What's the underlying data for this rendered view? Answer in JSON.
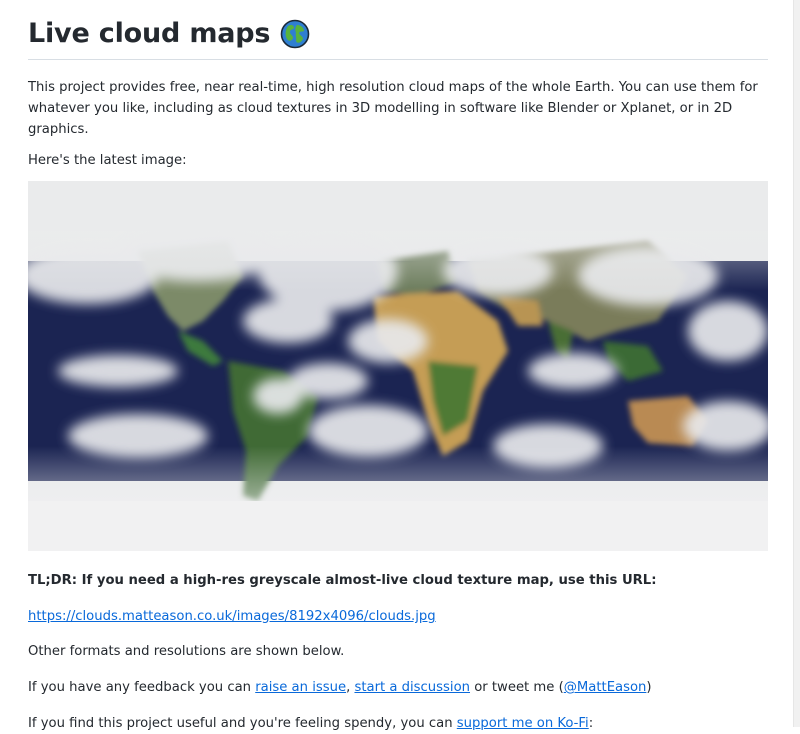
{
  "header": {
    "title": "Live cloud maps"
  },
  "intro": {
    "text": "This project provides free, near real-time, high resolution cloud maps of the whole Earth. You can use them for whatever you like, including as cloud textures in 3D modelling in software like Blender or Xplanet, or in 2D graphics."
  },
  "latest": {
    "text": "Here's the latest image:"
  },
  "tldr": {
    "text": "TL;DR: If you need a high-res greyscale almost-live cloud texture map, use this URL:"
  },
  "cloud_url": {
    "text": "https://clouds.matteason.co.uk/images/8192x4096/clouds.jpg"
  },
  "formats": {
    "text": "Other formats and resolutions are shown below."
  },
  "feedback": {
    "prefix": "If you have any feedback you can ",
    "issue_link": "raise an issue",
    "comma": ", ",
    "discussion_link": "start a discussion",
    "middle": " or tweet me (",
    "twitter_link": "@MattEason",
    "suffix": ")"
  },
  "support": {
    "prefix": "If you find this project useful and you're feeling spendy, you can ",
    "kofi_link": "support me on Ko-Fi",
    "suffix": ":"
  },
  "colors": {
    "link": "#0969da",
    "text": "#24292f",
    "ocean": "#1a2350",
    "cloud": "#ecedef"
  }
}
